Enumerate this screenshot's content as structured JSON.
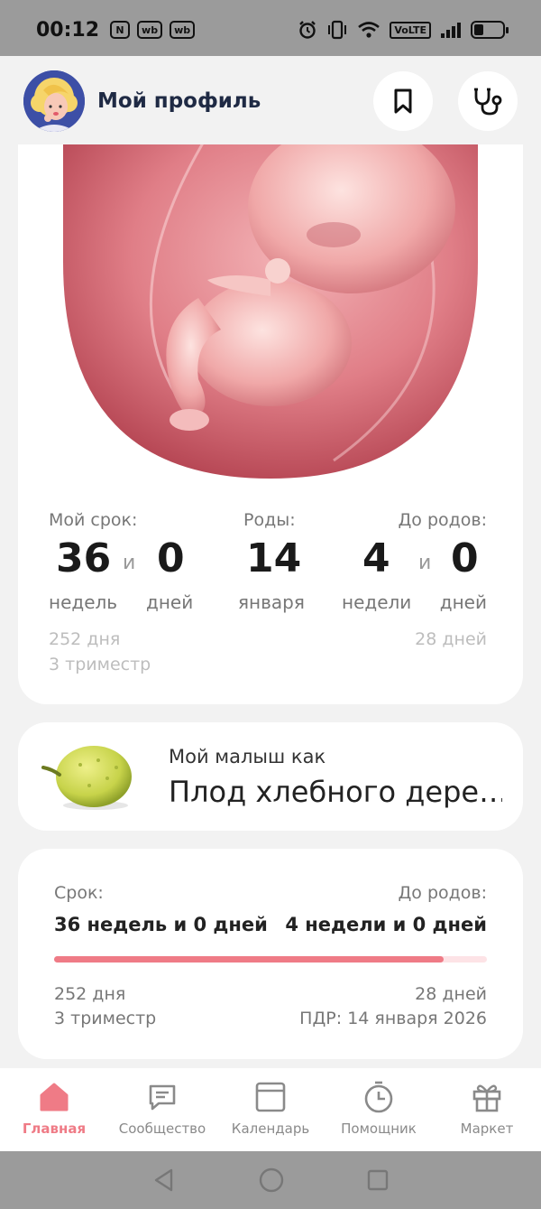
{
  "status_bar": {
    "time": "00:12",
    "badges": [
      "N",
      "wb",
      "wb"
    ],
    "network": "VoLTE",
    "battery_level": 0.35
  },
  "header": {
    "title": "Мой профиль",
    "icons": [
      "avatar",
      "bookmark-icon",
      "stethoscope-icon"
    ]
  },
  "term": {
    "my_term_label": "Мой срок:",
    "weeks_value": "36",
    "conj1": "и",
    "days_value": "0",
    "weeks_unit": "недель",
    "days_unit": "дней",
    "birth_label": "Роды:",
    "birth_day": "14",
    "birth_month": "января",
    "until_label": "До родов:",
    "until_weeks": "4",
    "conj2": "и",
    "until_days": "0",
    "until_weeks_unit": "недели",
    "until_days_unit": "дней",
    "total_days": "252 дня",
    "trimester": "3 триместр",
    "days_left": "28 дней"
  },
  "baby": {
    "subtitle": "Мой малыш как",
    "fruit_name": "Плод хлебного дере…"
  },
  "progress": {
    "term_label": "Срок:",
    "term_value": "36 недель и 0 дней",
    "until_label": "До родов:",
    "until_value": "4 недели и 0 дней",
    "fraction": 0.9,
    "total_days": "252 дня",
    "trimester": "3 триместр",
    "days_left": "28 дней",
    "due_date": "ПДР: 14 января 2026"
  },
  "nav": {
    "items": [
      {
        "label": "Главная",
        "icon": "home-icon",
        "active": true
      },
      {
        "label": "Сообщество",
        "icon": "chat-icon",
        "active": false
      },
      {
        "label": "Календарь",
        "icon": "calendar-icon",
        "active": false
      },
      {
        "label": "Помощник",
        "icon": "stopwatch-icon",
        "active": false
      },
      {
        "label": "Маркет",
        "icon": "gift-icon",
        "active": false
      }
    ]
  },
  "colors": {
    "accent": "#ef7b86",
    "track": "#fde3e6",
    "background": "#f2f2f2"
  }
}
